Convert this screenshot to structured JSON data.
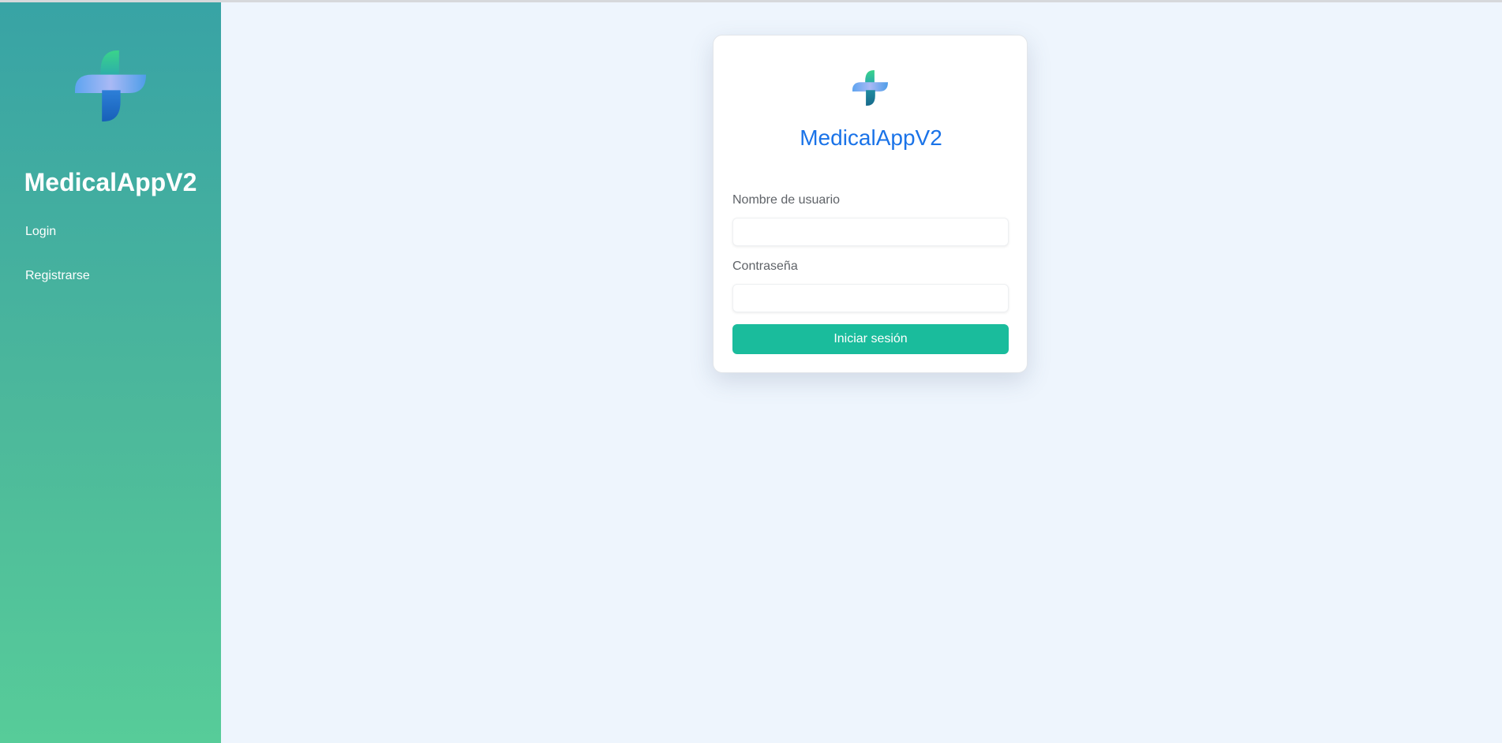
{
  "app": {
    "brand": "MedicalAppV2"
  },
  "sidebar": {
    "items": [
      {
        "label": "Login"
      },
      {
        "label": "Registrarse"
      }
    ]
  },
  "login_form": {
    "title": "MedicalAppV2",
    "username_label": "Nombre de usuario",
    "username_value": "",
    "password_label": "Contraseña",
    "password_value": "",
    "submit_label": "Iniciar sesión"
  },
  "colors": {
    "sidebar_gradient_top": "#38a3a5",
    "sidebar_gradient_bottom": "#57cc99",
    "page_background": "#eef5fd",
    "title_blue": "#1a73e8",
    "button_teal": "#1abc9c"
  },
  "icons": {
    "logo": "medical-cross-icon"
  }
}
